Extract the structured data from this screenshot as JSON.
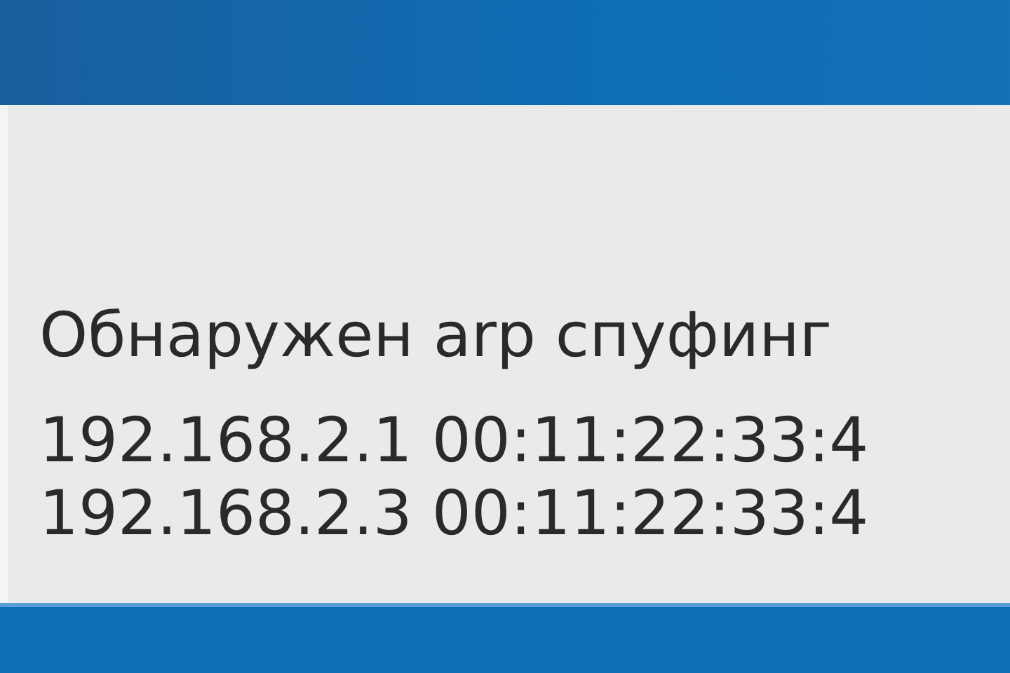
{
  "notification": {
    "title": "Обнаружен arp спуфинг",
    "lines": [
      "192.168.2.1 00:11:22:33:4",
      "192.168.2.3 00:11:22:33:4"
    ]
  }
}
